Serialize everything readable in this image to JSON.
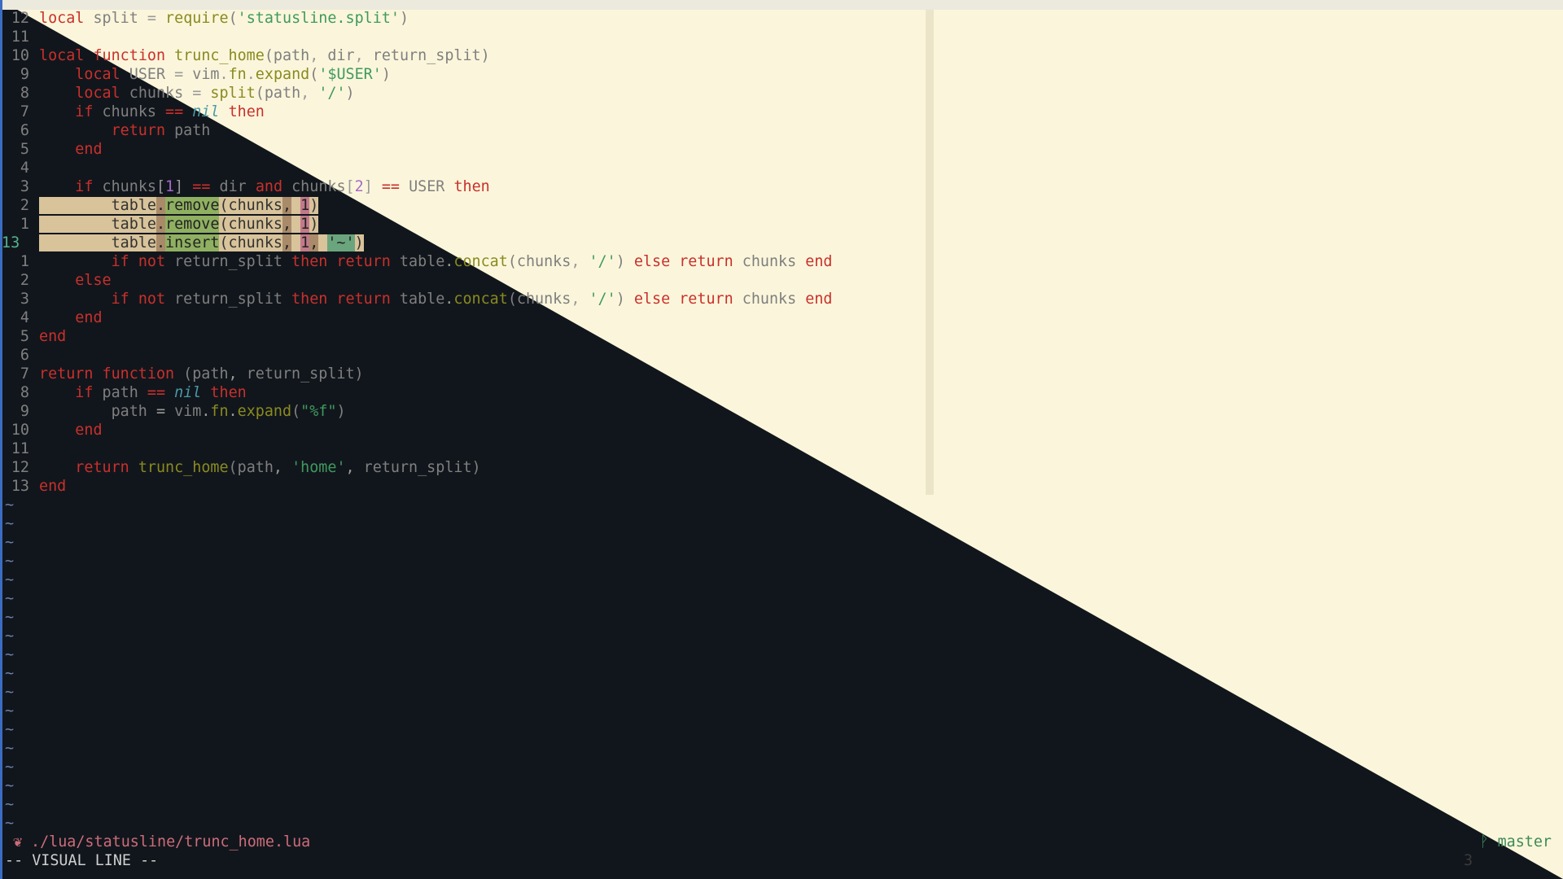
{
  "theme": {
    "light_bg": "#fbf6db",
    "dark_bg": "#11161c",
    "keyword": "#c9302c",
    "string": "#3f9a5e",
    "func": "#8a8a20"
  },
  "lines": [
    {
      "n": "12",
      "t": "local split = require('statusline.split')"
    },
    {
      "n": "11",
      "t": ""
    },
    {
      "n": "10",
      "t": "local function trunc_home(path, dir, return_split)"
    },
    {
      "n": "9",
      "t": "    local USER = vim.fn.expand('$USER')"
    },
    {
      "n": "8",
      "t": "    local chunks = split(path, '/')"
    },
    {
      "n": "7",
      "t": "    if chunks == nil then"
    },
    {
      "n": "6",
      "t": "        return path"
    },
    {
      "n": "5",
      "t": "    end"
    },
    {
      "n": "4",
      "t": ""
    },
    {
      "n": "3",
      "t": "    if chunks[1] == dir and chunks[2] == USER then"
    },
    {
      "n": "2",
      "t": "        table.remove(chunks, 1)"
    },
    {
      "n": "1",
      "t": "        table.remove(chunks, 1)"
    },
    {
      "n": "13",
      "t": "        table.insert(chunks, 1, '~')"
    },
    {
      "n": "1",
      "t": "        if not return_split then return table.concat(chunks, '/') else return chunks end"
    },
    {
      "n": "2",
      "t": "    else"
    },
    {
      "n": "3",
      "t": "        if not return_split then return table.concat(chunks, '/') else return chunks end"
    },
    {
      "n": "4",
      "t": "    end"
    },
    {
      "n": "5",
      "t": "end"
    },
    {
      "n": "6",
      "t": ""
    },
    {
      "n": "7",
      "t": "return function (path, return_split)"
    },
    {
      "n": "8",
      "t": "    if path == nil then"
    },
    {
      "n": "9",
      "t": "        path = vim.fn.expand(\"%f\")"
    },
    {
      "n": "10",
      "t": "    end"
    },
    {
      "n": "11",
      "t": ""
    },
    {
      "n": "12",
      "t": "    return trunc_home(path, 'home', return_split)"
    },
    {
      "n": "13",
      "t": "end"
    }
  ],
  "tilde": "~",
  "statusline": {
    "icon": "❦",
    "file": "./lua/statusline/trunc_home.lua",
    "branch_icon": "ᚹ",
    "branch": "master"
  },
  "cmdline": {
    "mode": "-- VISUAL LINE --",
    "count": "3"
  }
}
